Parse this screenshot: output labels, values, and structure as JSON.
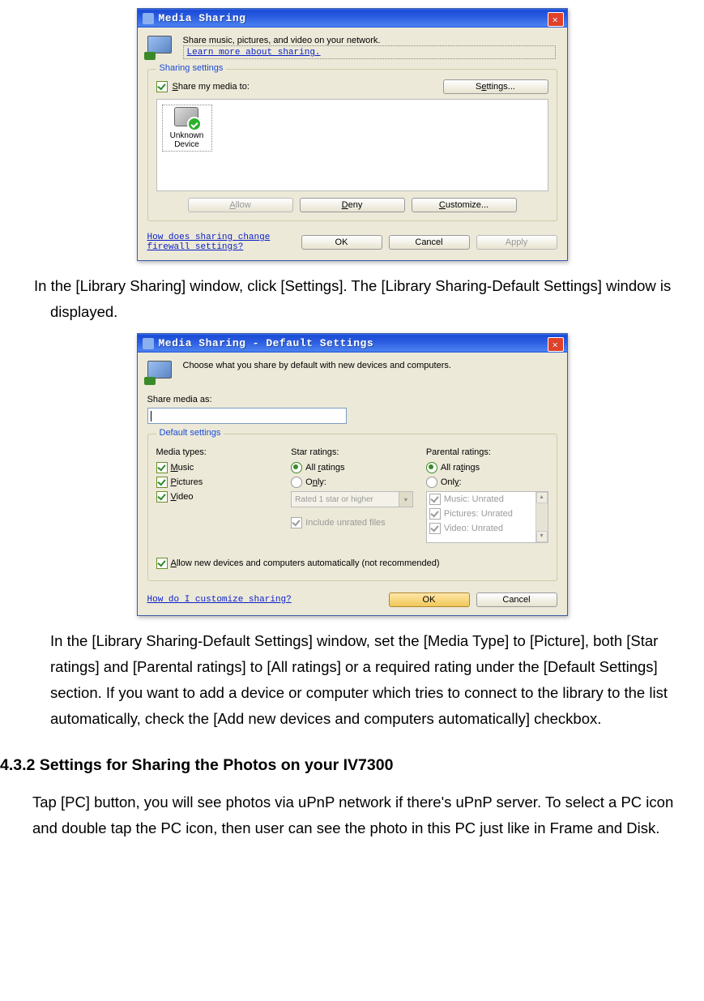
{
  "dialog1": {
    "title": "Media Sharing",
    "description": "Share music, pictures, and video on your network.",
    "learn_more": "Learn more about sharing.",
    "fieldset_label": "Sharing settings",
    "share_checkbox_label": "Share my media to:",
    "settings_button": "Settings...",
    "device_label_l1": "Unknown",
    "device_label_l2": "Device",
    "allow_button": "Allow",
    "deny_button": "Deny",
    "customize_button": "Customize...",
    "firewall_link": "How does sharing change firewall settings?",
    "ok_button": "OK",
    "cancel_button": "Cancel",
    "apply_button": "Apply"
  },
  "paragraph1": "In the [Library Sharing] window, click [Settings]. The [Library Sharing-Default Settings] window is displayed.",
  "dialog2": {
    "title": "Media Sharing - Default Settings",
    "description": "Choose what you share by default with new devices and computers.",
    "share_as_label": "Share media as:",
    "fieldset_label": "Default settings",
    "media_types_label": "Media types:",
    "media_music": "Music",
    "media_pictures": "Pictures",
    "media_video": "Video",
    "star_label": "Star ratings:",
    "star_all": "All ratings",
    "star_only": "Only:",
    "star_combo": "Rated 1 star or higher",
    "include_unrated": "Include unrated files",
    "parental_label": "Parental ratings:",
    "parental_all": "All ratings",
    "parental_only": "Only:",
    "list_music": "Music: Unrated",
    "list_pictures": "Pictures: Unrated",
    "list_video": "Video: Unrated",
    "allow_new_label": "Allow new devices and computers automatically (not recommended)",
    "customize_link": "How do I customize sharing?",
    "ok_button": "OK",
    "cancel_button": "Cancel"
  },
  "paragraph2": "In the [Library Sharing-Default Settings] window, set the [Media Type] to [Picture], both [Star ratings] and [Parental ratings] to [All ratings] or a required rating under the [Default Settings] section. If you want to add a device or computer which tries to connect to the library to the list automatically, check the [Add new devices and computers automatically] checkbox.",
  "heading": "4.3.2 Settings for Sharing the Photos on your IV7300",
  "paragraph3": "Tap [PC] button, you will see photos via uPnP network if there's uPnP server. To select a PC icon and double tap the PC icon, then user can see the photo in this PC just like in Frame and Disk."
}
